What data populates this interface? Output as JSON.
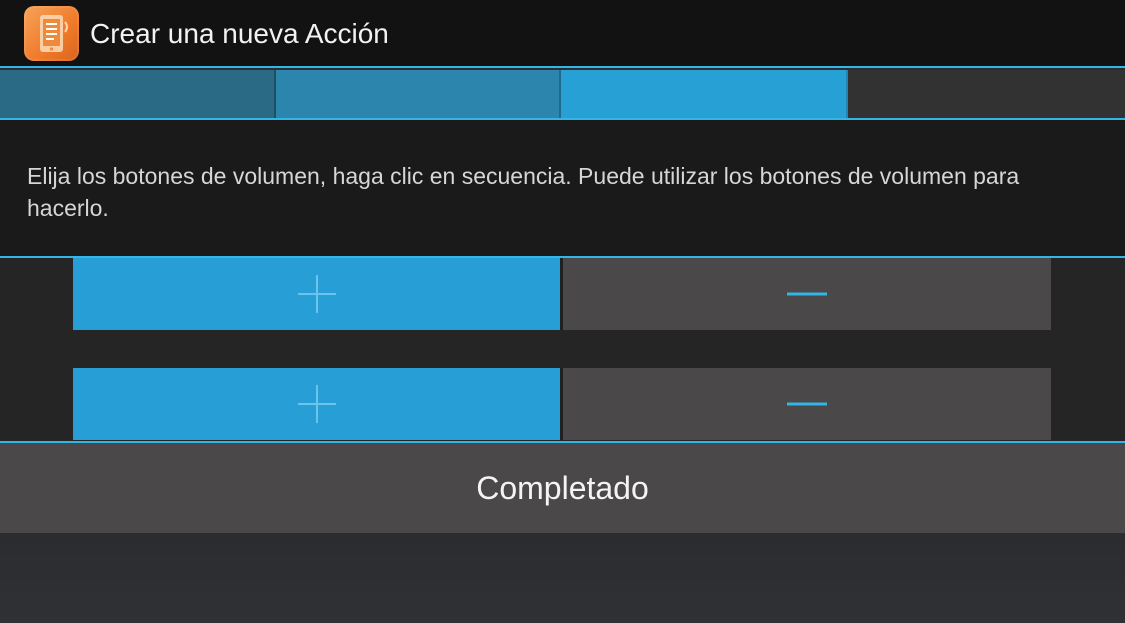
{
  "header": {
    "title": "Crear una nueva Acción",
    "app_icon": "task-app-icon"
  },
  "progress": {
    "steps_total": 4,
    "current_step": 3,
    "colors": {
      "completed_dark": "#2a6a84",
      "completed": "#2b85ad",
      "current": "#27a0d6",
      "pending": "#333232",
      "accent": "#33b5e5"
    }
  },
  "content": {
    "instruction": "Elija los botones de volumen, haga clic en secuencia. Puede utilizar los botones de volumen para hacerlo."
  },
  "sequence": {
    "rows": [
      {
        "plus_icon": "plus-icon",
        "minus_icon": "minus-icon",
        "selected": "plus"
      },
      {
        "plus_icon": "plus-icon",
        "minus_icon": "minus-icon",
        "selected": "plus"
      }
    ]
  },
  "footer": {
    "done_label": "Completado"
  }
}
